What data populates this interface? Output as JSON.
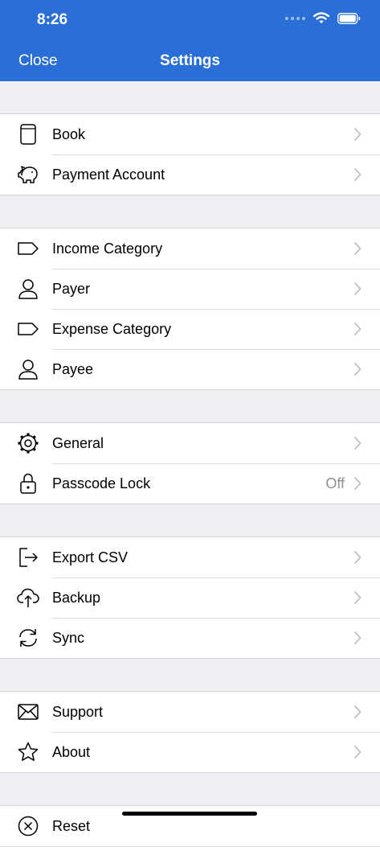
{
  "status": {
    "time": "8:26"
  },
  "nav": {
    "close_label": "Close",
    "title": "Settings"
  },
  "groups": [
    [
      {
        "label": "Book",
        "icon": "book-icon"
      },
      {
        "label": "Payment Account",
        "icon": "piggy-bank-icon"
      }
    ],
    [
      {
        "label": "Income Category",
        "icon": "tag-icon"
      },
      {
        "label": "Payer",
        "icon": "person-icon"
      },
      {
        "label": "Expense Category",
        "icon": "tag-icon"
      },
      {
        "label": "Payee",
        "icon": "person-icon"
      }
    ],
    [
      {
        "label": "General",
        "icon": "gear-icon"
      },
      {
        "label": "Passcode Lock",
        "icon": "lock-icon",
        "value": "Off"
      }
    ],
    [
      {
        "label": "Export CSV",
        "icon": "export-icon"
      },
      {
        "label": "Backup",
        "icon": "cloud-upload-icon"
      },
      {
        "label": "Sync",
        "icon": "sync-icon"
      }
    ],
    [
      {
        "label": "Support",
        "icon": "envelope-icon"
      },
      {
        "label": "About",
        "icon": "star-icon"
      }
    ],
    [
      {
        "label": "Reset",
        "icon": "circle-x-icon"
      }
    ]
  ],
  "colors": {
    "header": "#2a6fd8",
    "background": "#efeff4",
    "secondary_text": "#8e8e93"
  }
}
